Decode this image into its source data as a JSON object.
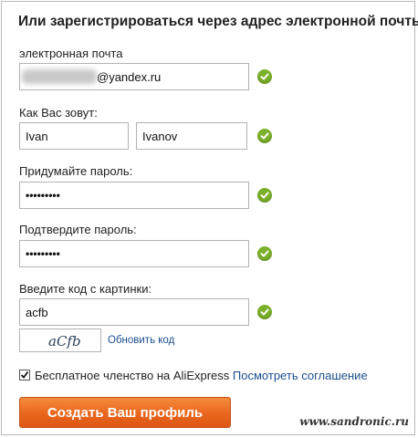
{
  "title": "Или зарегистрироваться через адрес электронной почты:",
  "email": {
    "label": "электронная почта",
    "value_visible": "@yandex.ru"
  },
  "name": {
    "label": "Как Вас зовут:",
    "first_value": "Ivan",
    "last_value": "Ivanov"
  },
  "password": {
    "label": "Придумайте пароль:",
    "value": "•••••••••"
  },
  "confirm_password": {
    "label": "Подтвердите пароль:",
    "value": "•••••••••"
  },
  "captcha": {
    "label": "Введите код с картинки:",
    "value": "acfb",
    "image_text": "aCfb",
    "refresh_label": "Обновить код"
  },
  "membership": {
    "checked": true,
    "text": "Бесплатное членство на AliExpress",
    "link_text": "Посмотреть соглашение"
  },
  "submit_label": "Создать Ваш профиль",
  "watermark": "www.sandronic.ru",
  "colors": {
    "accent_orange": "#e8661d",
    "valid_green": "#7bb02b",
    "link_blue": "#1b4e8e"
  },
  "icons": {
    "valid": "check-circle-icon",
    "checkbox": "checkbox-checked-icon"
  }
}
